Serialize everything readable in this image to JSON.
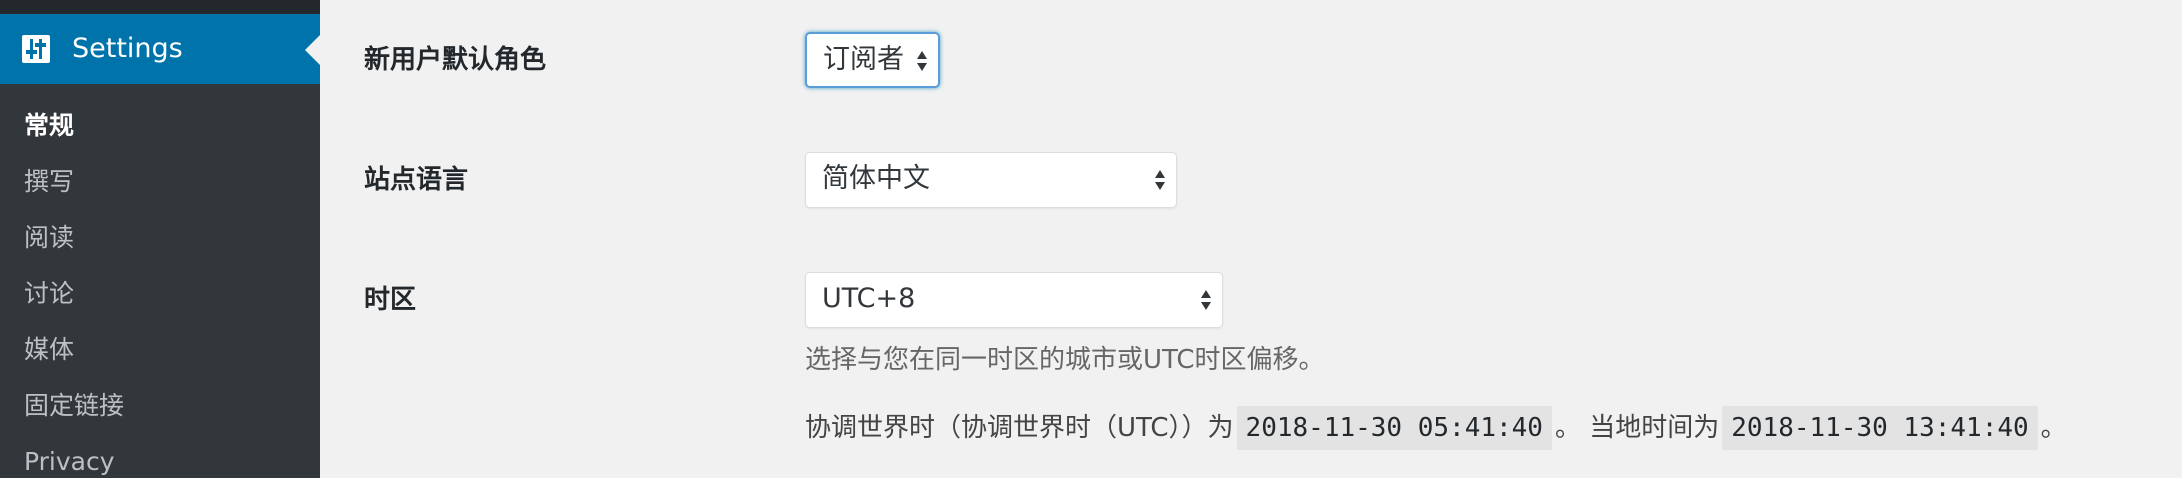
{
  "sidebar": {
    "settings_menu": {
      "label": "Settings",
      "icon": "settings-sliders-icon"
    },
    "submenu": [
      {
        "label": "常规",
        "current": true
      },
      {
        "label": "撰写",
        "current": false
      },
      {
        "label": "阅读",
        "current": false
      },
      {
        "label": "讨论",
        "current": false
      },
      {
        "label": "媒体",
        "current": false
      },
      {
        "label": "固定链接",
        "current": false
      },
      {
        "label": "Privacy",
        "current": false
      }
    ]
  },
  "form": {
    "default_role": {
      "label": "新用户默认角色",
      "value": "订阅者"
    },
    "site_language": {
      "label": "站点语言",
      "value": "简体中文"
    },
    "timezone": {
      "label": "时区",
      "value": "UTC+8",
      "description": "选择与您在同一时区的城市或UTC时区偏移。",
      "utc_prefix": "协调世界时（协调世界时（UTC））为",
      "utc_time": "2018-11-30 05:41:40",
      "local_prefix": "。 当地时间为",
      "local_time": "2018-11-30 13:41:40",
      "suffix": "。"
    }
  },
  "colors": {
    "sidebar_bg": "#32373c",
    "accent": "#0073aa",
    "page_bg": "#f1f1f1",
    "focus": "#5b9dd9"
  }
}
